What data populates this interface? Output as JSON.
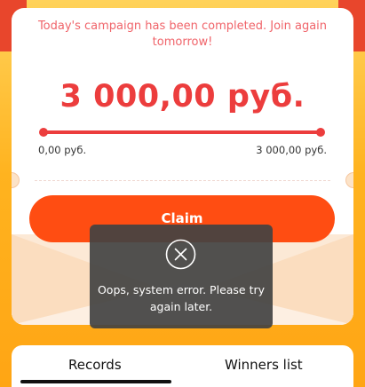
{
  "campaign": {
    "notice": "Today's campaign has been completed. Join again tomorrow!",
    "amount": "3 000,00 руб.",
    "progress": {
      "fraction": 1.0,
      "min_label": "0,00 руб.",
      "max_label": "3 000,00 руб."
    },
    "claim_label": "Claim"
  },
  "toast": {
    "icon": "close-circle-icon",
    "message": "Oops, system error. Please try again later."
  },
  "tabs": [
    {
      "label": "Records",
      "selected": true
    },
    {
      "label": "Winners list",
      "selected": false
    }
  ],
  "colors": {
    "background": "#FFB31F",
    "accent_red": "#EC3D3D",
    "button": "#FF4D12",
    "notice_text": "#F0646A",
    "toast_bg": "#424242"
  }
}
